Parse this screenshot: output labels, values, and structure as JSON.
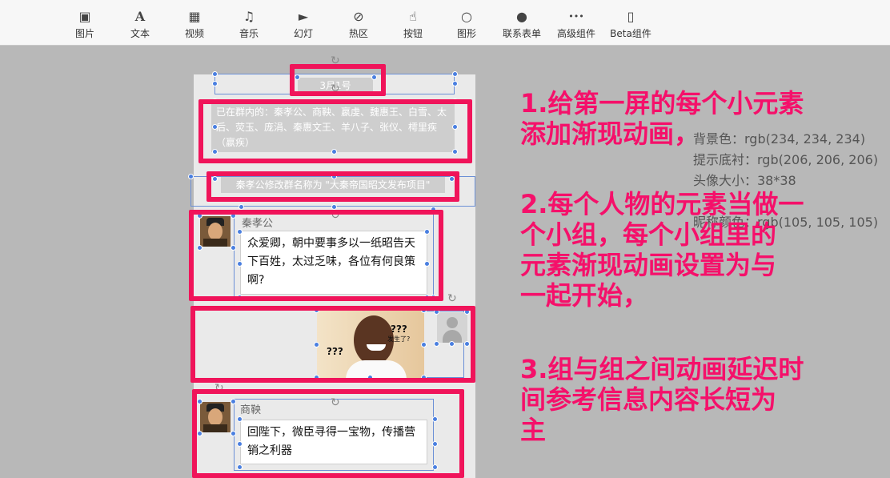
{
  "toolbar": {
    "items": [
      {
        "label": "图片",
        "icon": "image-icon",
        "glyph": "▣"
      },
      {
        "label": "文本",
        "icon": "text-icon",
        "glyph": "A"
      },
      {
        "label": "视频",
        "icon": "video-icon",
        "glyph": "▦"
      },
      {
        "label": "音乐",
        "icon": "music-icon",
        "glyph": "♫"
      },
      {
        "label": "幻灯",
        "icon": "slideshow-icon",
        "glyph": "►"
      },
      {
        "label": "热区",
        "icon": "hotspot-icon",
        "glyph": "⊘"
      },
      {
        "label": "按钮",
        "icon": "button-tap-icon",
        "glyph": "☝"
      },
      {
        "label": "图形",
        "icon": "shape-circle-icon",
        "glyph": "○"
      },
      {
        "label": "联系表单",
        "icon": "contact-form-icon",
        "glyph": "●"
      },
      {
        "label": "高级组件",
        "icon": "more-icon",
        "glyph": "•••"
      },
      {
        "label": "Beta组件",
        "icon": "beta-component-icon",
        "glyph": "▯"
      }
    ]
  },
  "canvas": {
    "date": "3月1号",
    "group_notice": "已在群内的：秦孝公、商鞅、嬴虔、魏惠王、白雪、太后、荧玉、庞涓、秦惠文王、羊八子、张仪、樗里疾（嬴疾）",
    "rename_notice": "秦孝公修改群名称为 \"大秦帝国昭文发布项目\"",
    "messages": [
      {
        "name": "秦孝公",
        "text": "众爱卿，朝中要事多以一纸昭告天下百姓，太过乏味，各位有何良策啊?"
      },
      {
        "meme_text_1": "???",
        "meme_text_2": "???",
        "meme_sub": "发生了?"
      },
      {
        "name": "商鞅",
        "text": "回陛下，微臣寻得一宝物，传播营销之利器"
      }
    ]
  },
  "annotations": {
    "note1": [
      "1.给第一屏的每个小元素",
      "添加渐现动画，"
    ],
    "note2": [
      "2.每个人物的元素当做一",
      "个小组，每个小组里的",
      "元素渐现动画设置为与",
      "一起开始，"
    ],
    "note3": [
      "3.组与组之间动画延迟时",
      "间参考信息内容长短为",
      "主"
    ]
  },
  "properties": {
    "bg": "背景色：rgb(234, 234, 234)",
    "notice_bg": "提示底衬：rgb(206, 206, 206)",
    "avatar_size": "头像大小：38*38",
    "name_color": "昵称颜色：rgb(105, 105, 105)"
  },
  "colors": {
    "accent": "#f0145a",
    "canvas_bg": "#eaeaea",
    "handle": "#4a7fe0"
  }
}
